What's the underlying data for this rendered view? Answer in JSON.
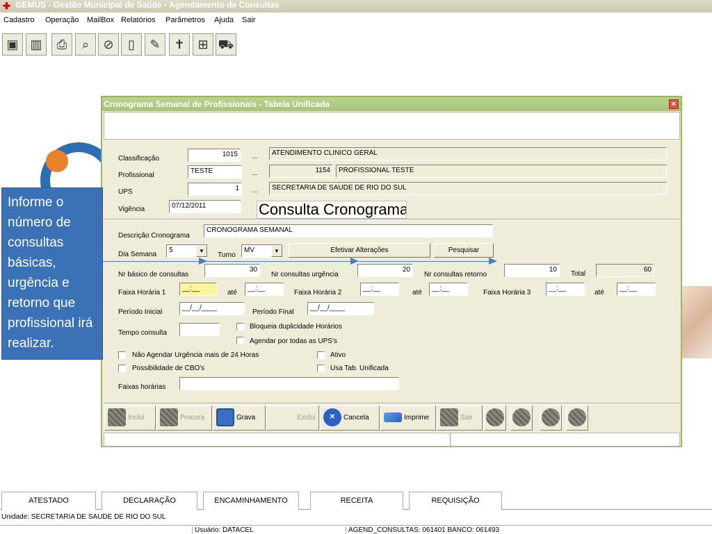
{
  "app": {
    "title": "GEMUS - Gestão Municipal de Saúde - Agendamento de Consultas"
  },
  "menu": [
    "Cadastro",
    "Operação",
    "MailBox",
    "Relatórios",
    "Parâmetros",
    "Ajuda",
    "Sair"
  ],
  "toolbar_icons": [
    "computer-icon",
    "building-icon",
    "printer-icon",
    "magnifier-icon",
    "pill-icon",
    "clipboard-icon",
    "syringe-icon",
    "cross-icon",
    "medical-kit-icon",
    "ambulance-icon"
  ],
  "callout": {
    "text": "Informe o número de consultas básicas, urgência e retorno que profissional irá realizar."
  },
  "dialog": {
    "title": "Cronograma Semanal de Profissionais - Tabela Unificada",
    "close": "×",
    "classificacao": {
      "label": "Classificação",
      "code": "1015",
      "dots": "...",
      "desc": "ATENDIMENTO CLINICO GERAL"
    },
    "profissional": {
      "label": "Profissional",
      "value": "TESTE",
      "dots": "...",
      "code": "1154",
      "desc": "PROFISSIONAL TESTE"
    },
    "ups": {
      "label": "UPS",
      "code": "1",
      "dots": "...",
      "desc": "SECRETARIA DE SAUDE DE RIO DO SUL"
    },
    "vigencia": {
      "label": "Vigência",
      "value": "07/12/2011"
    },
    "consulta_btn": "Consulta Cronograma Básico",
    "descricao": {
      "label": "Descrição Cronograma",
      "value": "CRONOGRAMA SEMANAL"
    },
    "dia_semana": {
      "label": "Dia Semana",
      "value": "5"
    },
    "turno": {
      "label": "Turno",
      "value": "MV"
    },
    "efetivar_btn": "Efetivar Alterações",
    "pesquisar_btn": "Pesquisar",
    "nr_basico": {
      "label": "Nr básico de consultas",
      "value": "30"
    },
    "nr_urgencia": {
      "label": "Nr consultas urgência",
      "value": "20"
    },
    "nr_retorno": {
      "label": "Nr consultas retorno",
      "value": "10"
    },
    "total": {
      "label": "Total",
      "value": "60"
    },
    "faixa1": {
      "label": "Faixa Horária 1",
      "start": "__:__",
      "ate": "até",
      "end": "__:__"
    },
    "faixa2": {
      "label": "Faixa Horária 2",
      "start": "__:__",
      "ate": "até",
      "end": "__:__"
    },
    "faixa3": {
      "label": "Faixa Horária 3",
      "start": "__:__",
      "ate": "até",
      "end": "__:__"
    },
    "periodo_inicial": {
      "label": "Período Inicial",
      "value": "__/__/____"
    },
    "periodo_final": {
      "label": "Período Final",
      "value": "__/__/____"
    },
    "tempo_consulta": {
      "label": "Tempo consulta",
      "value": ""
    },
    "chk_bloqueia": "Bloqueia duplicidade Horários",
    "chk_agendar_todas": "Agendar por todas as UPS's",
    "chk_nao_agendar": "Não Agendar Urgência mais de 24 Horas",
    "chk_ativo": "Ativo",
    "chk_cbo": "Possibilidade de CBO's",
    "chk_usa_tab": "Usa Tab. Unificada",
    "faixas_horarias": {
      "label": "Faixas horárias",
      "value": ""
    },
    "actions": {
      "inclui": "Inclui",
      "procura": "Procura",
      "grava": "Grava",
      "exclui": "Exclui",
      "cancela": "Cancela",
      "imprime": "Imprime",
      "sair": "Sair"
    }
  },
  "bottom_tabs": [
    "ATESTADO",
    "DECLARAÇÃO",
    "ENCAMINHAMENTO",
    "RECEITA",
    "REQUISIÇÃO"
  ],
  "unidade": "Unidade: SECRETARIA DE SAUDE DE RIO DO SUL",
  "status": {
    "usuario": "Usuário: DATACEL",
    "agend": "AGEND_CONSULTAS: 061401 BANCO: 061493"
  }
}
